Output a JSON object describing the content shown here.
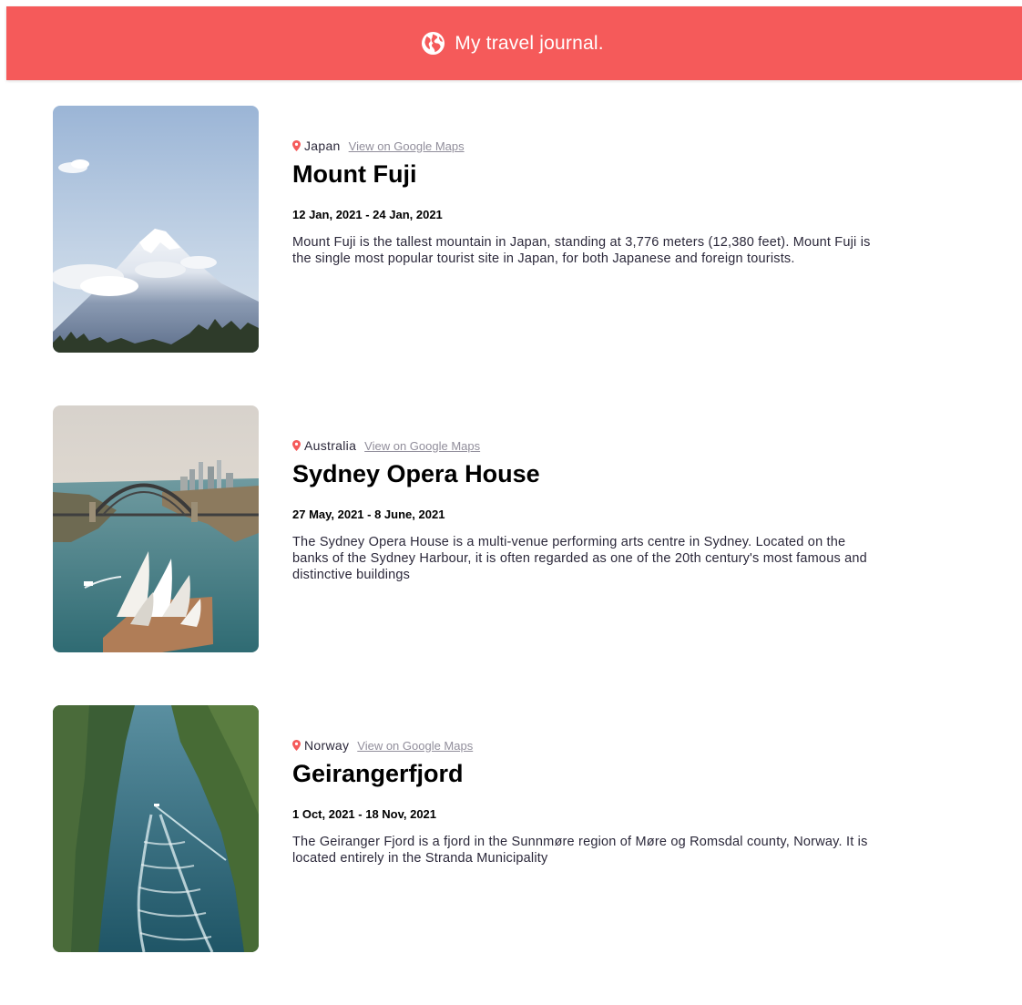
{
  "navbar": {
    "title": "My travel journal.",
    "icon": "globe-icon",
    "background_color": "#f55a5a"
  },
  "entries": [
    {
      "country": "Japan",
      "maps_label": "View on Google Maps",
      "title": "Mount Fuji",
      "dates": "12 Jan, 2021 - 24 Jan, 2021",
      "description": "Mount Fuji is the tallest mountain in Japan, standing at 3,776 meters (12,380 feet). Mount Fuji is the single most popular tourist site in Japan, for both Japanese and foreign tourists.",
      "image": "mount-fuji-photo"
    },
    {
      "country": "Australia",
      "maps_label": "View on Google Maps",
      "title": "Sydney Opera House",
      "dates": "27 May, 2021 - 8 June, 2021",
      "description": "The Sydney Opera House is a multi-venue performing arts centre in Sydney. Located on the banks of the Sydney Harbour, it is often regarded as one of the 20th century's most famous and distinctive buildings",
      "image": "sydney-opera-house-photo"
    },
    {
      "country": "Norway",
      "maps_label": "View on Google Maps",
      "title": "Geirangerfjord",
      "dates": "1 Oct, 2021 - 18 Nov, 2021",
      "description": "The Geiranger Fjord is a fjord in the Sunnmøre region of Møre og Romsdal county, Norway. It is located entirely in the Stranda Municipality",
      "image": "geirangerfjord-photo"
    }
  ],
  "colors": {
    "accent": "#f55a5a",
    "link": "#918e9b",
    "text": "#2b283a"
  }
}
